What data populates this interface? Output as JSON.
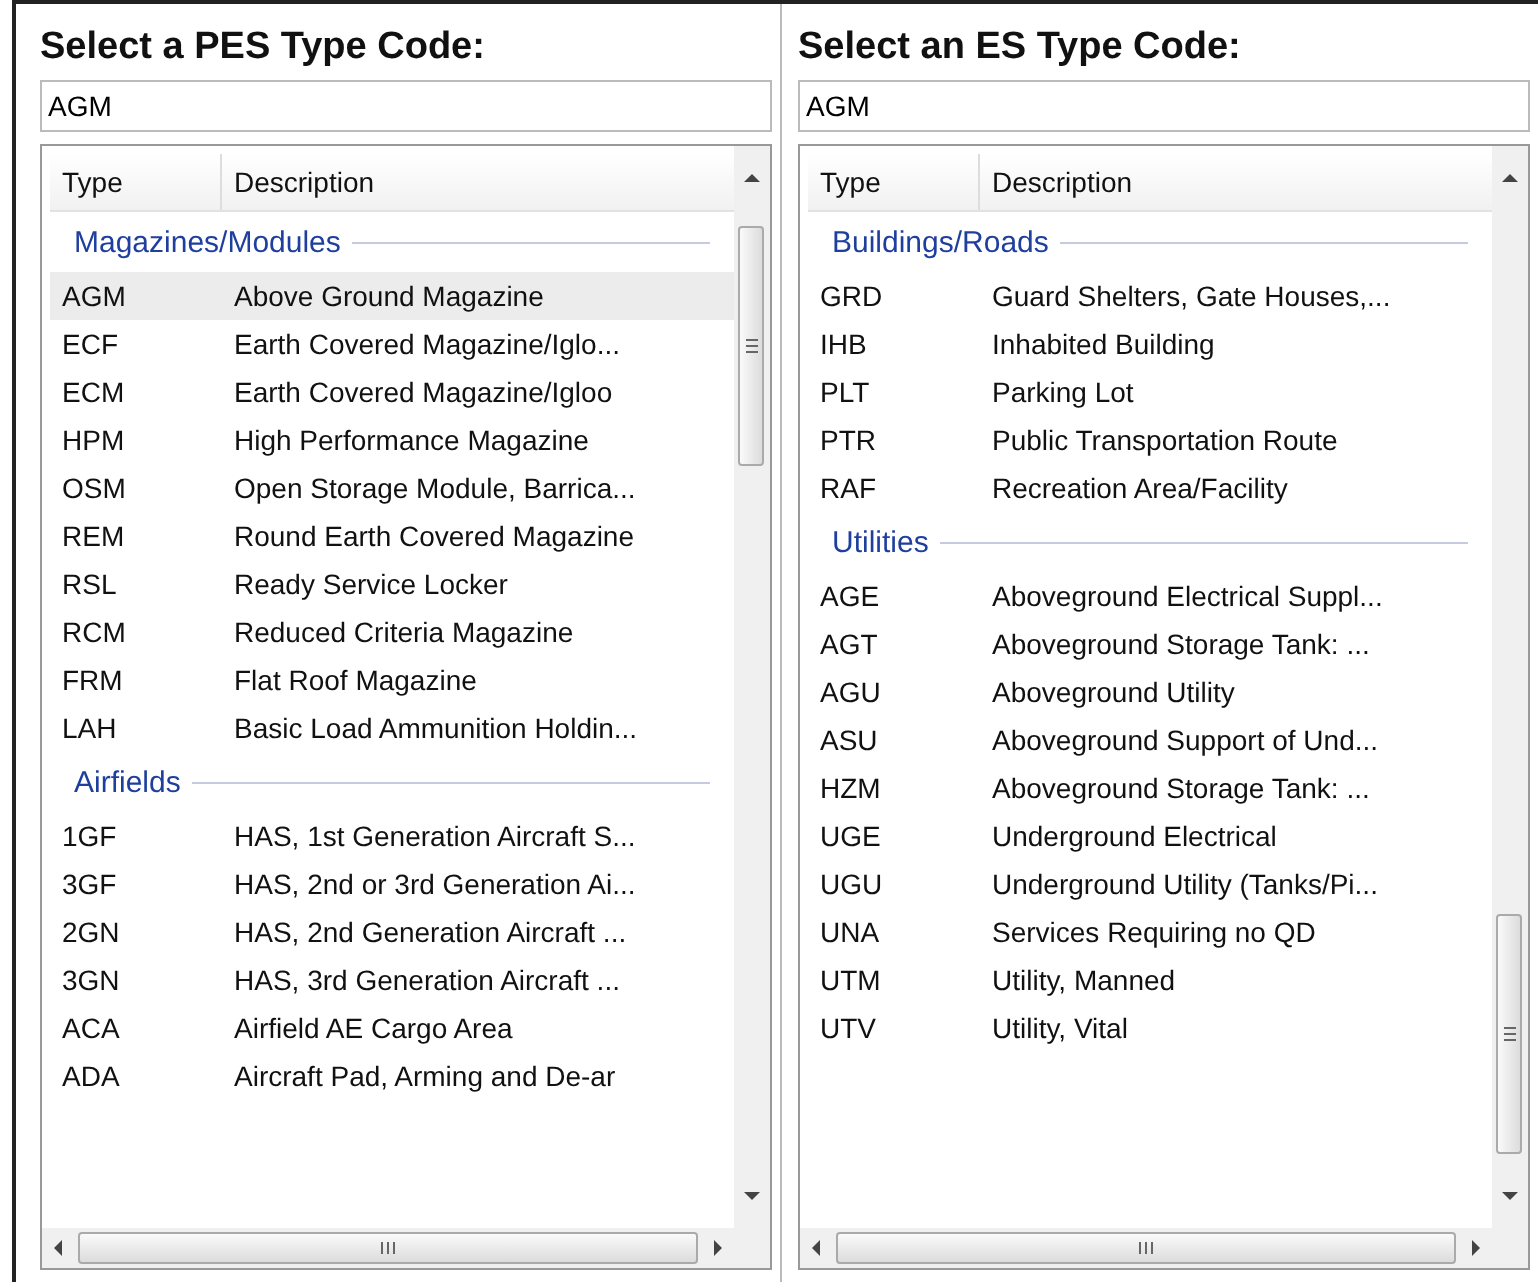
{
  "panels": [
    {
      "title": "Select a PES Type Code:",
      "search": {
        "value": "AGM"
      },
      "columns": [
        "Type",
        "Description"
      ],
      "groups": [
        {
          "label": "Magazines/Modules",
          "rows": [
            {
              "type": "AGM",
              "description": "Above Ground Magazine",
              "selected": true
            },
            {
              "type": "ECF",
              "description": "Earth Covered Magazine/Iglo...",
              "selected": false
            },
            {
              "type": "ECM",
              "description": "Earth Covered Magazine/Igloo",
              "selected": false
            },
            {
              "type": "HPM",
              "description": "High Performance Magazine",
              "selected": false
            },
            {
              "type": "OSM",
              "description": "Open Storage Module, Barrica...",
              "selected": false
            },
            {
              "type": "REM",
              "description": "Round Earth Covered Magazine",
              "selected": false
            },
            {
              "type": "RSL",
              "description": "Ready Service Locker",
              "selected": false
            },
            {
              "type": "RCM",
              "description": "Reduced Criteria Magazine",
              "selected": false
            },
            {
              "type": "FRM",
              "description": "Flat Roof Magazine",
              "selected": false
            },
            {
              "type": "LAH",
              "description": "Basic Load Ammunition Holdin...",
              "selected": false
            }
          ]
        },
        {
          "label": "Airfields",
          "rows": [
            {
              "type": "1GF",
              "description": "HAS, 1st Generation Aircraft S...",
              "selected": false
            },
            {
              "type": "3GF",
              "description": "HAS, 2nd or 3rd Generation Ai...",
              "selected": false
            },
            {
              "type": "2GN",
              "description": "HAS, 2nd Generation Aircraft ...",
              "selected": false
            },
            {
              "type": "3GN",
              "description": "HAS, 3rd Generation Aircraft ...",
              "selected": false
            },
            {
              "type": "ACA",
              "description": "Airfield AE Cargo Area",
              "selected": false
            },
            {
              "type": "ADA",
              "description": "Aircraft Pad, Arming and De-ar",
              "selected": false
            }
          ]
        }
      ]
    },
    {
      "title": "Select an ES Type Code:",
      "search": {
        "value": "AGM"
      },
      "columns": [
        "Type",
        "Description"
      ],
      "groups": [
        {
          "label": "Buildings/Roads",
          "rows": [
            {
              "type": "GRD",
              "description": "Guard Shelters, Gate Houses,...",
              "selected": false
            },
            {
              "type": "IHB",
              "description": "Inhabited Building",
              "selected": false
            },
            {
              "type": "PLT",
              "description": "Parking Lot",
              "selected": false
            },
            {
              "type": "PTR",
              "description": "Public Transportation Route",
              "selected": false
            },
            {
              "type": "RAF",
              "description": "Recreation Area/Facility",
              "selected": false
            }
          ]
        },
        {
          "label": "Utilities",
          "rows": [
            {
              "type": "AGE",
              "description": "Aboveground Electrical Suppl...",
              "selected": false
            },
            {
              "type": "AGT",
              "description": "Aboveground Storage Tank: ...",
              "selected": false
            },
            {
              "type": "AGU",
              "description": "Aboveground Utility",
              "selected": false
            },
            {
              "type": "ASU",
              "description": "Aboveground Support of Und...",
              "selected": false
            },
            {
              "type": "HZM",
              "description": "Aboveground Storage Tank: ...",
              "selected": false
            },
            {
              "type": "UGE",
              "description": "Underground Electrical",
              "selected": false
            },
            {
              "type": "UGU",
              "description": "Underground Utility (Tanks/Pi...",
              "selected": false
            },
            {
              "type": "UNA",
              "description": "Services Requiring no QD",
              "selected": false
            },
            {
              "type": "UTM",
              "description": "Utility, Manned",
              "selected": false
            },
            {
              "type": "UTV",
              "description": "Utility, Vital",
              "selected": false
            }
          ]
        }
      ]
    }
  ]
}
